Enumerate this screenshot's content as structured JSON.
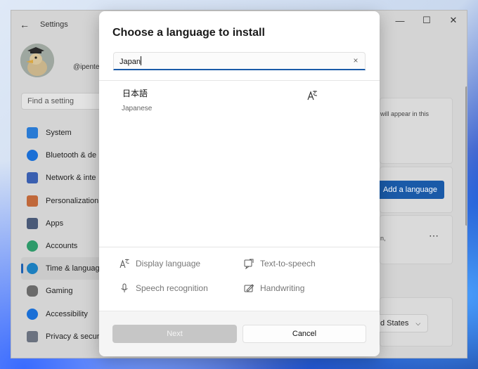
{
  "settings_window": {
    "title": "Settings",
    "username": "@ipente",
    "find_placeholder": "Find a setting",
    "nav": [
      {
        "label": "System",
        "icon": "monitor-icon",
        "color": "#2a7bd4"
      },
      {
        "label": "Bluetooth & de",
        "icon": "bluetooth-icon",
        "color": "#1a6fd6"
      },
      {
        "label": "Network & inte",
        "icon": "wifi-icon",
        "color": "#3a5fb0"
      },
      {
        "label": "Personalization",
        "icon": "brush-icon",
        "color": "#c0683a"
      },
      {
        "label": "Apps",
        "icon": "apps-icon",
        "color": "#4a5a78"
      },
      {
        "label": "Accounts",
        "icon": "person-icon",
        "color": "#2e9a6a"
      },
      {
        "label": "Time & languag",
        "icon": "globe-clock-icon",
        "color": "#1c7fbf"
      },
      {
        "label": "Gaming",
        "icon": "controller-icon",
        "color": "#6a6a6a"
      },
      {
        "label": "Accessibility",
        "icon": "accessibility-icon",
        "color": "#1a6fd6"
      },
      {
        "label": "Privacy & secur",
        "icon": "shield-icon",
        "color": "#6b7280"
      }
    ],
    "card_hint": "will appear in this",
    "add_language_button": "Add a language",
    "options_partial": "n,",
    "region_value": "d States",
    "minimize_glyph": "—",
    "maximize_glyph": "☐",
    "close_glyph": "✕",
    "back_glyph": "←"
  },
  "dialog": {
    "title": "Choose a language to install",
    "search_value": "Japan",
    "clear_glyph": "×",
    "results": [
      {
        "native": "日本語",
        "english": "Japanese",
        "feature_icon": "display-language-icon"
      }
    ],
    "features": [
      {
        "label": "Display language",
        "icon": "display-language-icon"
      },
      {
        "label": "Text-to-speech",
        "icon": "text-to-speech-icon"
      },
      {
        "label": "Speech recognition",
        "icon": "microphone-icon"
      },
      {
        "label": "Handwriting",
        "icon": "handwriting-icon"
      }
    ],
    "next_button": "Next",
    "cancel_button": "Cancel"
  },
  "colors": {
    "accent": "#1a5aa8",
    "disabled_button": "#c6c6c6"
  }
}
